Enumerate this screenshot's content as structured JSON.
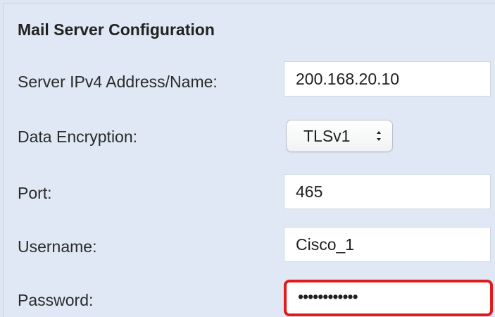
{
  "section": {
    "title": "Mail Server Configuration"
  },
  "fields": {
    "server_address": {
      "label": "Server IPv4 Address/Name:",
      "value": "200.168.20.10"
    },
    "data_encryption": {
      "label": "Data Encryption:",
      "selected": "TLSv1"
    },
    "port": {
      "label": "Port:",
      "value": "465"
    },
    "username": {
      "label": "Username:",
      "value": "Cisco_1"
    },
    "password": {
      "label": "Password:",
      "masked_value": "••••••••••••"
    }
  },
  "colors": {
    "panel_background": "#dfe8f4",
    "highlight_border": "#e11a1a"
  },
  "icons": {
    "select_arrows": "up-down-chevron-icon"
  }
}
